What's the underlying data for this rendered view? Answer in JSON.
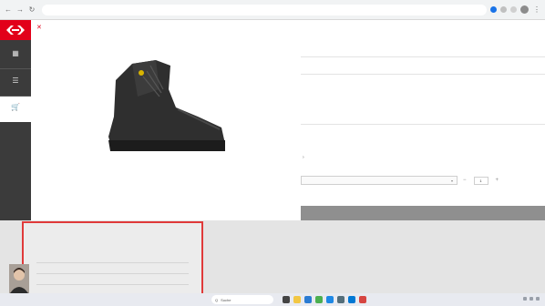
{
  "browser": {
    "url": ""
  },
  "sidebar": {
    "items": [
      {
        "label": ""
      },
      {
        "label": ""
      },
      {
        "label": ""
      }
    ]
  },
  "product": {
    "title": "",
    "price": "",
    "right_links": [
      "",
      ""
    ],
    "field_label": "",
    "field_value": "",
    "description": [
      "",
      "",
      "",
      "",
      ""
    ],
    "more_label": "",
    "compare_label": ""
  },
  "price_tiers": {
    "headers": [
      "",
      "",
      ""
    ],
    "prices": [
      "",
      "",
      ""
    ]
  },
  "order": {
    "select_placeholder": "",
    "quantity": "1",
    "note": "",
    "cart_label": ""
  },
  "overview": {
    "title": "",
    "headers": [
      "",
      ""
    ],
    "rows": [
      [
        "",
        "",
        ""
      ],
      [
        "",
        "",
        ""
      ],
      [
        "",
        "",
        ""
      ],
      [
        "",
        "",
        ""
      ]
    ]
  },
  "taskbar": {
    "search_placeholder": "Suche",
    "search_glyph": "Q"
  },
  "colors": {
    "brand_red": "#e2001a",
    "sidebar_dark": "#3b3b3b",
    "highlight_border": "#e03a3a",
    "cart_bar": "#8f8f8f"
  }
}
